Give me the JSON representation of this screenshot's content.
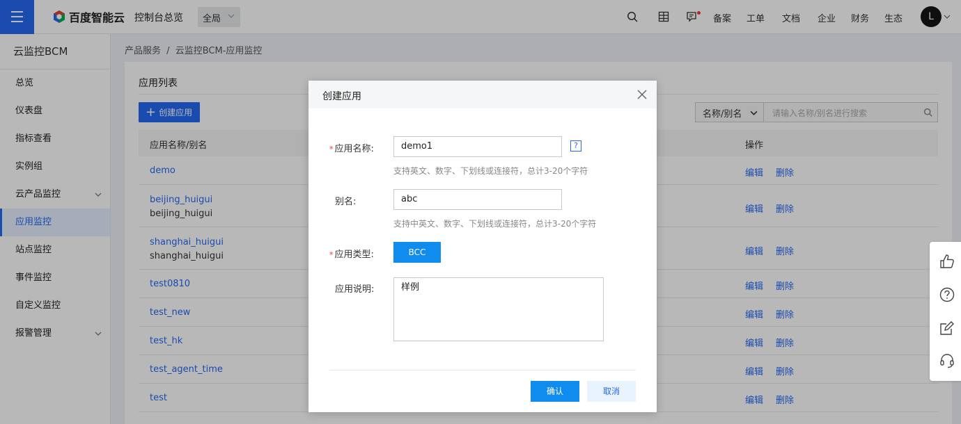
{
  "header": {
    "brand": "百度智能云",
    "console_title": "控制台总览",
    "region": "全局",
    "links": [
      "备案",
      "工单",
      "文档",
      "企业",
      "财务",
      "生态"
    ],
    "avatar_letter": "L"
  },
  "sidebar": {
    "title": "云监控BCM",
    "items": [
      {
        "label": "总览"
      },
      {
        "label": "仪表盘"
      },
      {
        "label": "指标查看"
      },
      {
        "label": "实例组"
      },
      {
        "label": "云产品监控"
      },
      {
        "label": "应用监控"
      },
      {
        "label": "站点监控"
      },
      {
        "label": "事件监控"
      },
      {
        "label": "自定义监控"
      },
      {
        "label": "报警管理"
      }
    ]
  },
  "breadcrumb": {
    "root": "产品服务",
    "sep": "/",
    "current": "云监控BCM-应用监控"
  },
  "panel": {
    "title": "应用列表",
    "create_label": "创建应用",
    "filter_select": "名称/别名",
    "search_placeholder": "请输入名称/别名进行搜索",
    "columns": {
      "name": "应用名称/别名",
      "ops": "操作"
    },
    "edit_label": "编辑",
    "delete_label": "删除",
    "rows": [
      {
        "name": "demo",
        "alias": ""
      },
      {
        "name": "beijing_huigui",
        "alias": "beijing_huigui"
      },
      {
        "name": "shanghai_huigui",
        "alias": "shanghai_huigui"
      },
      {
        "name": "test0810",
        "alias": ""
      },
      {
        "name": "test_new",
        "alias": ""
      },
      {
        "name": "test_hk",
        "alias": ""
      },
      {
        "name": "test_agent_time",
        "alias": ""
      },
      {
        "name": "test",
        "alias": ""
      }
    ]
  },
  "dialog": {
    "title": "创建应用",
    "name_label": "应用名称:",
    "name_value": "demo1",
    "name_hint": "支持英文、数字、下划线或连接符，总计3-20个字符",
    "help_mark": "?",
    "alias_label": "别名:",
    "alias_value": "abc",
    "alias_hint": "支持中英文、数字、下划线或连接符，总计3-20个字符",
    "type_label": "应用类型:",
    "type_value": "BCC",
    "desc_label": "应用说明:",
    "desc_value": "样例",
    "ok_label": "确认",
    "cancel_label": "取消",
    "required_mark": "*"
  },
  "colors": {
    "brand_blue": "#2468f2",
    "button_blue": "#108cee",
    "required_red": "#f33"
  }
}
